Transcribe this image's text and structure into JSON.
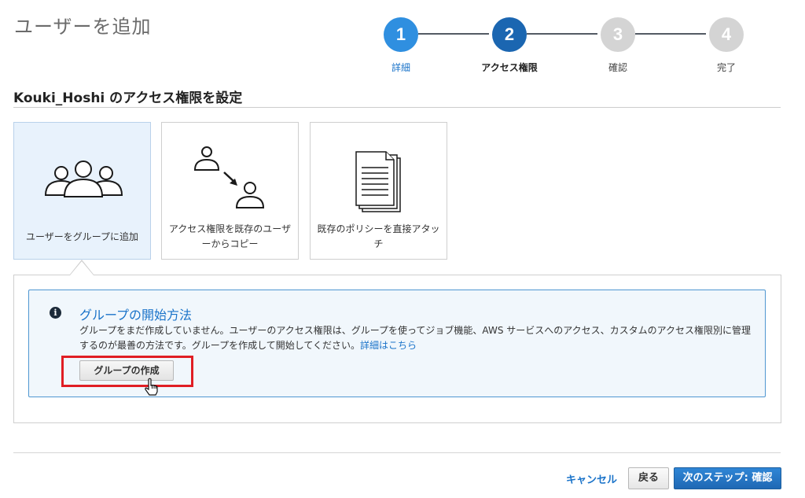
{
  "page": {
    "title": "ユーザーを追加"
  },
  "stepper": {
    "steps": [
      {
        "number": "1",
        "label": "詳細",
        "state": "completed"
      },
      {
        "number": "2",
        "label": "アクセス権限",
        "state": "current"
      },
      {
        "number": "3",
        "label": "確認",
        "state": "upcoming"
      },
      {
        "number": "4",
        "label": "完了",
        "state": "upcoming"
      }
    ],
    "colors": {
      "completed": "#2f8fe0",
      "current": "#1b66b1",
      "upcoming": "#d4d4d4"
    }
  },
  "section": {
    "title": "Kouki_Hoshi のアクセス権限を設定"
  },
  "options": [
    {
      "label": "ユーザーをグループに追加",
      "icon": "users-group-icon",
      "selected": true
    },
    {
      "label": "アクセス権限を既存のユーザーからコピー",
      "icon": "copy-user-icon",
      "selected": false
    },
    {
      "label": "既存のポリシーを直接アタッチ",
      "icon": "documents-icon",
      "selected": false
    }
  ],
  "info": {
    "icon": "info-icon",
    "title": "グループの開始方法",
    "text": "グループをまだ作成していません。ユーザーのアクセス権限は、グループを使ってジョブ機能、AWS サービスへのアクセス、カスタムのアクセス権限別に管理するのが最善の方法です。グループを作成して開始してください。",
    "link": "詳細はこちら",
    "create_button": "グループの作成"
  },
  "footer": {
    "cancel": "キャンセル",
    "back": "戻る",
    "next": "次のステップ: 確認"
  },
  "colors": {
    "accent": "#1a73c9",
    "highlight": "#e01e24",
    "primary_button": "#1f68b4"
  }
}
